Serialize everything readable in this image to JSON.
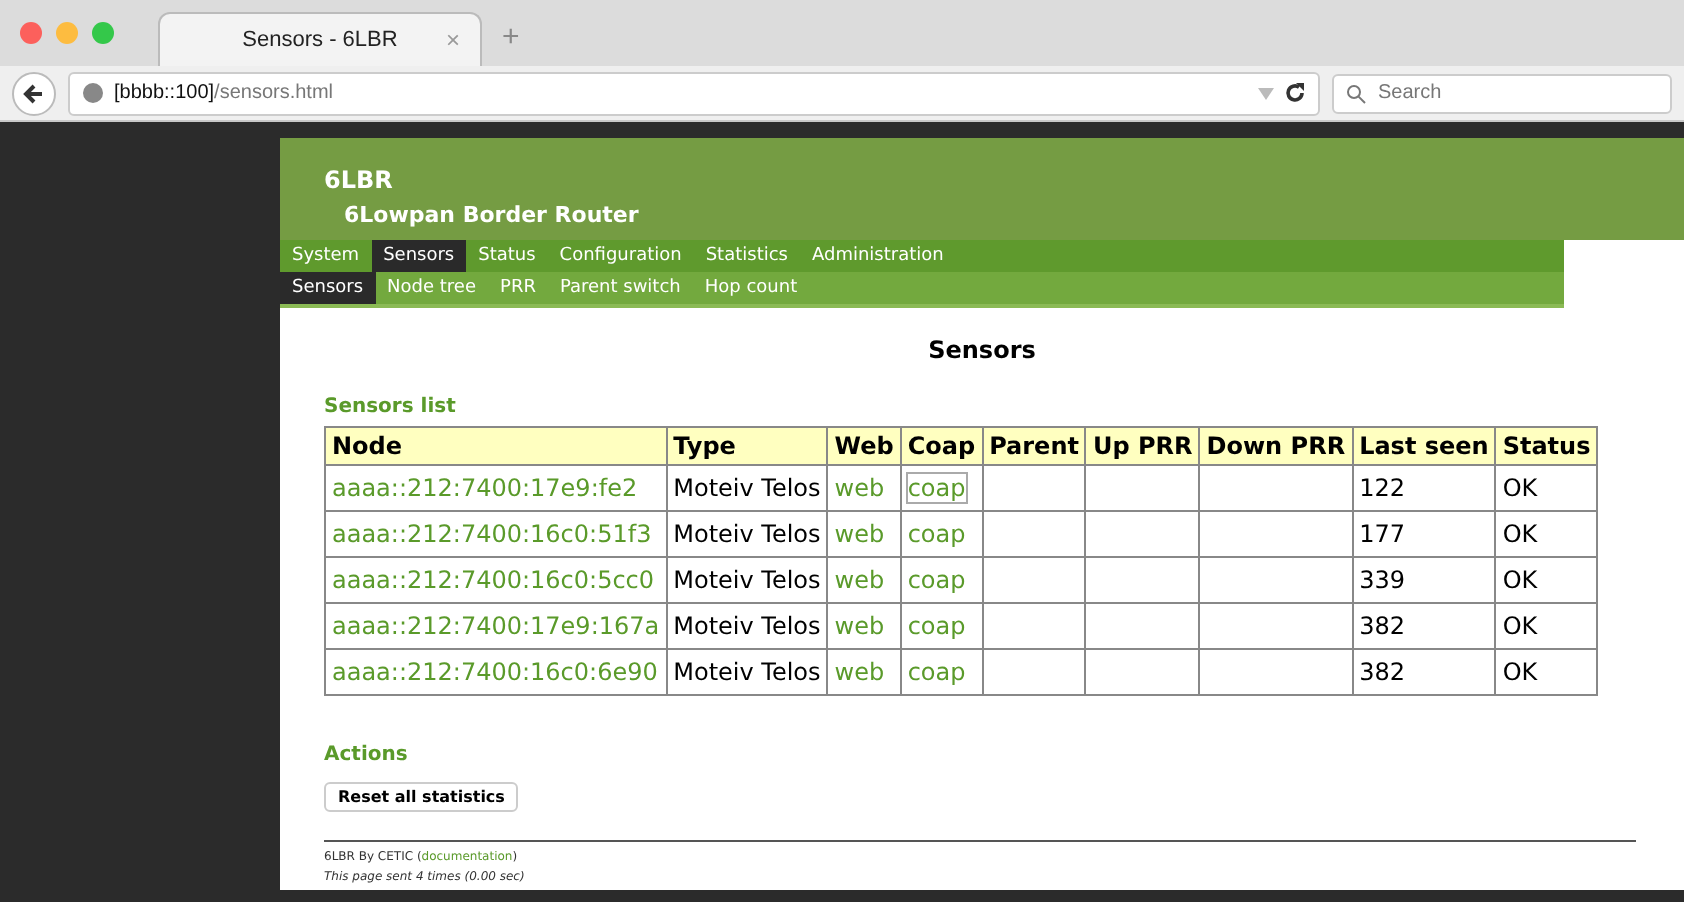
{
  "browser": {
    "tab_title": "Sensors - 6LBR",
    "tab_close": "×",
    "new_tab": "+",
    "url_host": "[bbbb::100]",
    "url_path": "/sensors.html",
    "search_placeholder": "Search"
  },
  "header": {
    "title": "6LBR",
    "subtitle": "6Lowpan Border Router"
  },
  "menu": [
    {
      "label": "System",
      "selected": false
    },
    {
      "label": "Sensors",
      "selected": true
    },
    {
      "label": "Status",
      "selected": false
    },
    {
      "label": "Configuration",
      "selected": false
    },
    {
      "label": "Statistics",
      "selected": false
    },
    {
      "label": "Administration",
      "selected": false
    }
  ],
  "submenu": [
    {
      "label": "Sensors",
      "selected": true
    },
    {
      "label": "Node tree",
      "selected": false
    },
    {
      "label": "PRR",
      "selected": false
    },
    {
      "label": "Parent switch",
      "selected": false
    },
    {
      "label": "Hop count",
      "selected": false
    }
  ],
  "page_title": "Sensors",
  "sensors_heading": "Sensors list",
  "table": {
    "columns": [
      "Node",
      "Type",
      "Web",
      "Coap",
      "Parent",
      "Up PRR",
      "Down PRR",
      "Last seen",
      "Status"
    ],
    "rows": [
      {
        "node": "aaaa::212:7400:17e9:fe2",
        "type": "Moteiv Telos",
        "web": "web",
        "coap": "coap",
        "coap_focused": true,
        "last_seen": "122",
        "status": "OK"
      },
      {
        "node": "aaaa::212:7400:16c0:51f3",
        "type": "Moteiv Telos",
        "web": "web",
        "coap": "coap",
        "coap_focused": false,
        "last_seen": "177",
        "status": "OK"
      },
      {
        "node": "aaaa::212:7400:16c0:5cc0",
        "type": "Moteiv Telos",
        "web": "web",
        "coap": "coap",
        "coap_focused": false,
        "last_seen": "339",
        "status": "OK"
      },
      {
        "node": "aaaa::212:7400:17e9:167a",
        "type": "Moteiv Telos",
        "web": "web",
        "coap": "coap",
        "coap_focused": false,
        "last_seen": "382",
        "status": "OK"
      },
      {
        "node": "aaaa::212:7400:16c0:6e90",
        "type": "Moteiv Telos",
        "web": "web",
        "coap": "coap",
        "coap_focused": false,
        "last_seen": "382",
        "status": "OK"
      }
    ]
  },
  "actions_heading": "Actions",
  "reset_button": "Reset all statistics",
  "footer": {
    "credit_prefix": "6LBR By CETIC (",
    "credit_link": "documentation",
    "credit_suffix": ")",
    "timing": "This page sent 4 times (0.00 sec)"
  }
}
